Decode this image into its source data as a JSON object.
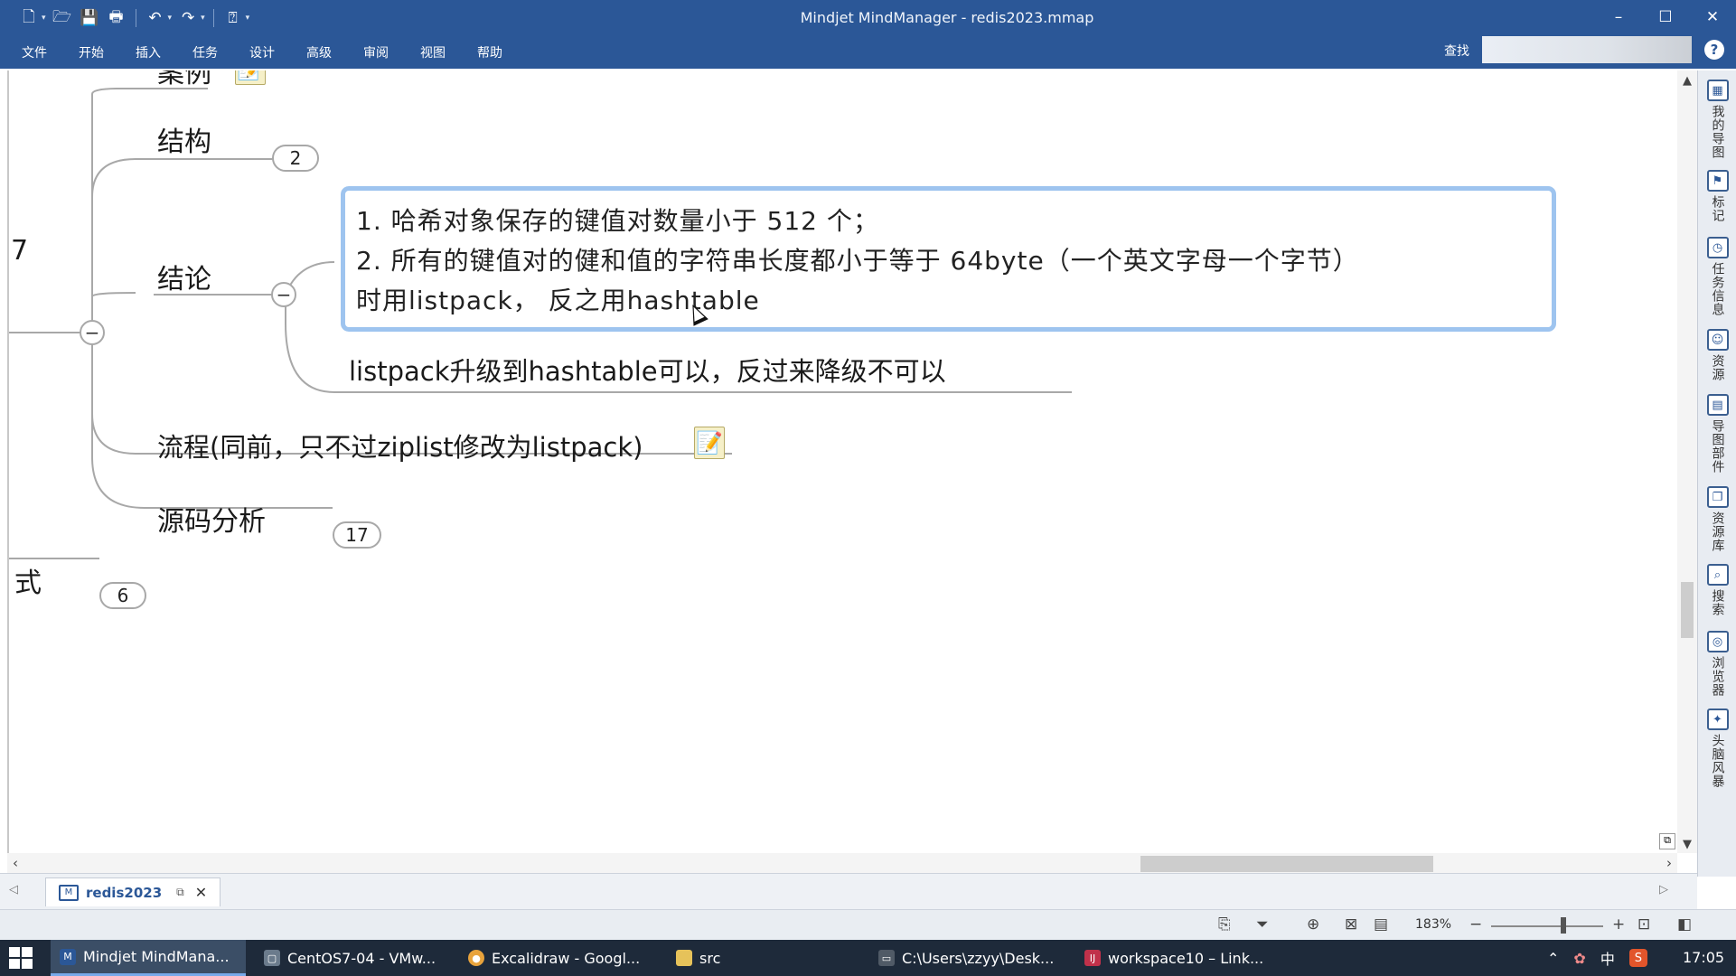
{
  "app": {
    "title": "Mindjet MindManager - redis2023.mmap",
    "minimize": "–",
    "maximize": "☐",
    "close": "✕"
  },
  "quick_access": {
    "new_icon": "new-document-icon",
    "open_icon": "open-folder-icon",
    "save_icon": "save-icon",
    "print_icon": "print-icon",
    "undo_icon": "undo-icon",
    "redo_icon": "redo-icon",
    "help_icon": "help-icon"
  },
  "menu": {
    "tabs": [
      "文件",
      "开始",
      "插入",
      "任务",
      "设计",
      "高级",
      "审阅",
      "视图",
      "帮助"
    ],
    "find_label": "查找",
    "help": "?"
  },
  "map": {
    "cutoff_top_topic": "案例",
    "cutoff_left_number": "7",
    "cutoff_left_text": "式",
    "topics": [
      {
        "label": "结构",
        "badge": "2"
      },
      {
        "label": "结论",
        "badge": ""
      },
      {
        "label": "流程(同前，只不过ziplist修改为listpack)",
        "badge": ""
      },
      {
        "label": "源码分析",
        "badge": "17"
      }
    ],
    "lower_badge": "6",
    "conclusion_box": {
      "line1": "1. 哈希对象保存的键值对数量小于 512 个；",
      "line2": "2. 所有的键值对的健和值的字符串长度都小于等于 64byte（一个英文字母一个字节）",
      "line3": "时用listpack， 反之用hashtable"
    },
    "conclusion_sub": "listpack升级到hashtable可以，反过来降级不可以",
    "collapse_symbol": "−"
  },
  "right_panel": [
    {
      "icon": "my-maps-icon",
      "label": "我的导图"
    },
    {
      "icon": "markers-icon",
      "label": "标记"
    },
    {
      "icon": "task-info-icon",
      "label": "任务信息"
    },
    {
      "icon": "resources-icon",
      "label": "资源"
    },
    {
      "icon": "map-parts-icon",
      "label": "导图部件"
    },
    {
      "icon": "library-icon",
      "label": "资源库"
    },
    {
      "icon": "search-icon",
      "label": "搜索"
    },
    {
      "icon": "browser-icon",
      "label": "浏览器"
    },
    {
      "icon": "brainstorm-icon",
      "label": "头脑风暴"
    }
  ],
  "doc_tabs": {
    "active": "redis2023",
    "float_icon": "⧉",
    "close": "✕"
  },
  "status": {
    "zoom": "183%"
  },
  "taskbar": {
    "items": [
      {
        "label": "Mindjet MindMana...",
        "icon": "mindmanager-icon",
        "color": "#2b5797"
      },
      {
        "label": "CentOS7-04 - VMw...",
        "icon": "vmware-icon",
        "color": "#6b7b8c"
      },
      {
        "label": "Excalidraw - Googl...",
        "icon": "chrome-icon",
        "color": "#e8a33c"
      },
      {
        "label": "src",
        "icon": "folder-icon",
        "color": "#e6c25a"
      },
      {
        "label": "C:\\Users\\zzyy\\Desk...",
        "icon": "terminal-icon",
        "color": "#505a66"
      },
      {
        "label": "workspace10 – Link...",
        "icon": "intellij-icon",
        "color": "#c0314a"
      }
    ],
    "tray_ime": "中",
    "clock": "17:05"
  }
}
